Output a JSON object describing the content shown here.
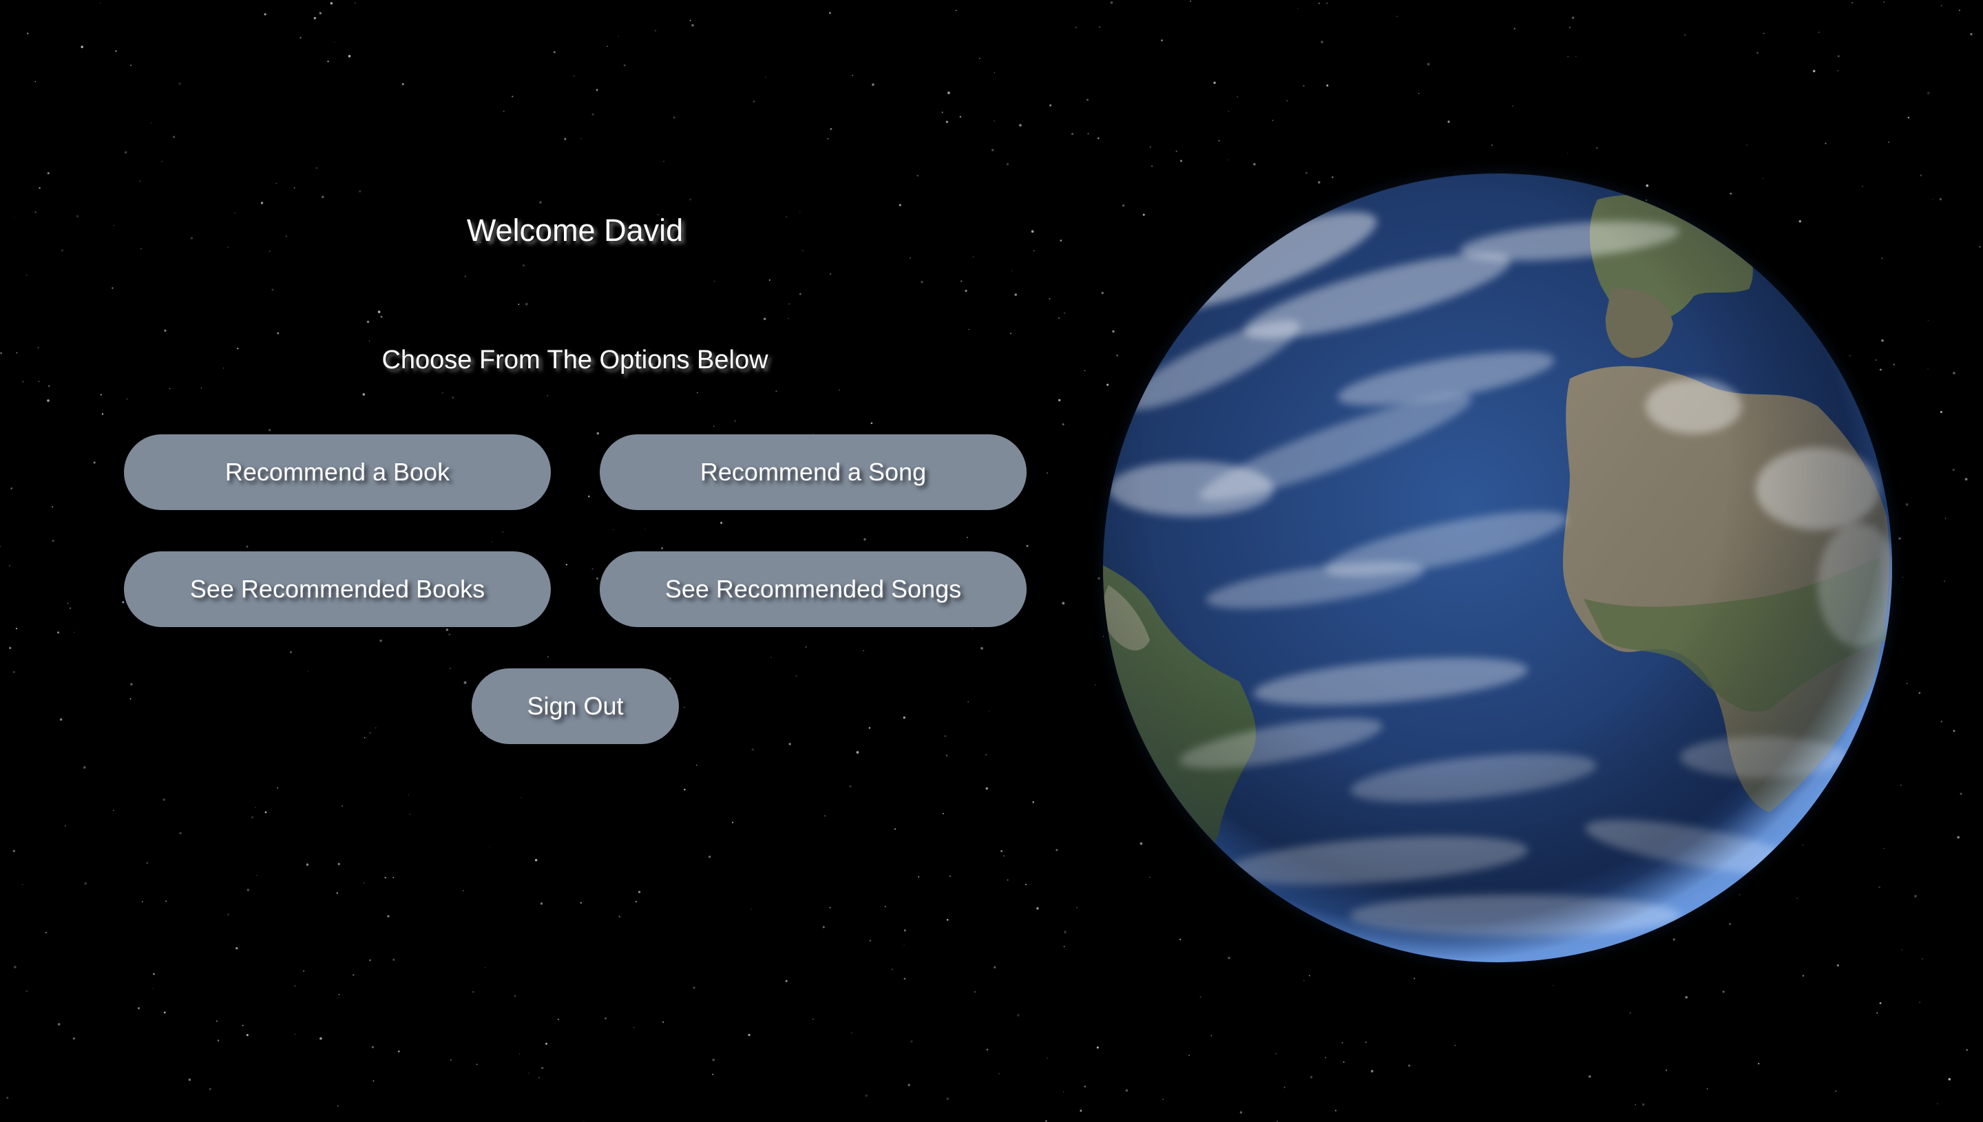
{
  "header": {
    "welcome_text": "Welcome David",
    "subtitle": "Choose From The Options Below"
  },
  "actions": {
    "recommend_book": "Recommend a Book",
    "recommend_song": "Recommend a Song",
    "see_books": "See Recommended Books",
    "see_songs": "See Recommended Songs",
    "sign_out": "Sign Out"
  },
  "theme": {
    "background": "#000000",
    "button_color": "#7f8b99",
    "text_color": "#ffffff",
    "globe_ocean": "#274a86",
    "globe_glow": "#5a8fd8"
  },
  "icons": {
    "background": "starfield",
    "decoration": "earth-globe"
  }
}
